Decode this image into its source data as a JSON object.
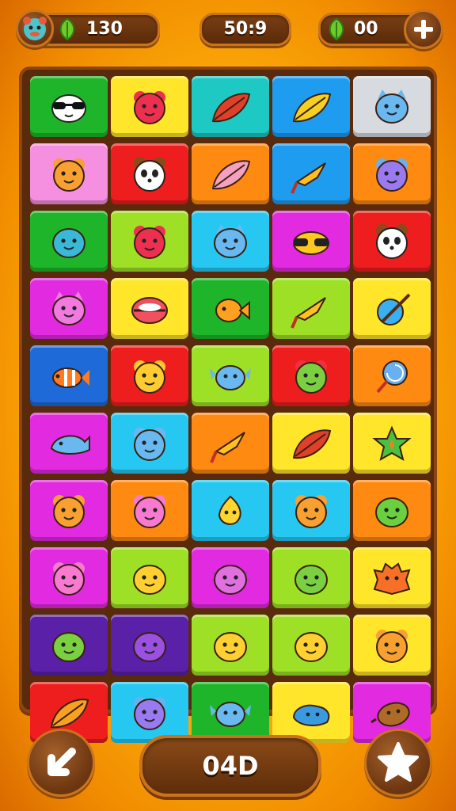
{
  "hud": {
    "lives_value": "130",
    "timer_value": "50:9",
    "coins_value": "00"
  },
  "bottom": {
    "center_value": "04D"
  },
  "colors": {
    "green": "#1fb52a",
    "yellow": "#ffe62a",
    "teal": "#1ec9c4",
    "blue": "#1e9cf0",
    "gray": "#d7dbe0",
    "pink": "#f58fe0",
    "red": "#ee1e1e",
    "orange": "#ff8a12",
    "lime": "#9de026",
    "cyan": "#26c8f2",
    "magenta": "#e22ae0",
    "purple": "#5a20a8",
    "royal": "#1e6ad8"
  },
  "tiles": [
    {
      "bg": "green",
      "icon": "panda-sunglasses"
    },
    {
      "bg": "yellow",
      "icon": "red-bear"
    },
    {
      "bg": "teal",
      "icon": "red-leaf"
    },
    {
      "bg": "blue",
      "icon": "yellow-leaf"
    },
    {
      "bg": "gray",
      "icon": "blue-cat"
    },
    {
      "bg": "pink",
      "icon": "orange-bear"
    },
    {
      "bg": "red",
      "icon": "panda-face"
    },
    {
      "bg": "orange",
      "icon": "pink-leaf"
    },
    {
      "bg": "blue",
      "icon": "kite"
    },
    {
      "bg": "orange",
      "icon": "purple-bear"
    },
    {
      "bg": "green",
      "icon": "teal-face"
    },
    {
      "bg": "lime",
      "icon": "red-bear"
    },
    {
      "bg": "cyan",
      "icon": "blue-cat"
    },
    {
      "bg": "magenta",
      "icon": "yellow-sunglasses"
    },
    {
      "bg": "red",
      "icon": "panda-face"
    },
    {
      "bg": "magenta",
      "icon": "pink-cat"
    },
    {
      "bg": "yellow",
      "icon": "red-clam"
    },
    {
      "bg": "green",
      "icon": "orange-fish"
    },
    {
      "bg": "lime",
      "icon": "kite"
    },
    {
      "bg": "yellow",
      "icon": "blue-ball"
    },
    {
      "bg": "royal",
      "icon": "clownfish"
    },
    {
      "bg": "red",
      "icon": "yellow-bear"
    },
    {
      "bg": "lime",
      "icon": "blue-fish"
    },
    {
      "bg": "red",
      "icon": "green-bear"
    },
    {
      "bg": "orange",
      "icon": "lollipop"
    },
    {
      "bg": "magenta",
      "icon": "blue-whale"
    },
    {
      "bg": "cyan",
      "icon": "blue-bear"
    },
    {
      "bg": "orange",
      "icon": "kite"
    },
    {
      "bg": "yellow",
      "icon": "red-leaf"
    },
    {
      "bg": "yellow",
      "icon": "green-star"
    },
    {
      "bg": "magenta",
      "icon": "orange-bear"
    },
    {
      "bg": "orange",
      "icon": "pink-bear"
    },
    {
      "bg": "cyan",
      "icon": "yellow-drop"
    },
    {
      "bg": "cyan",
      "icon": "orange-bear"
    },
    {
      "bg": "orange",
      "icon": "green-blob"
    },
    {
      "bg": "magenta",
      "icon": "pink-bear"
    },
    {
      "bg": "lime",
      "icon": "yellow-face"
    },
    {
      "bg": "magenta",
      "icon": "pink-axolotl"
    },
    {
      "bg": "lime",
      "icon": "green-face"
    },
    {
      "bg": "yellow",
      "icon": "orange-blob"
    },
    {
      "bg": "purple",
      "icon": "green-face"
    },
    {
      "bg": "purple",
      "icon": "purple-face"
    },
    {
      "bg": "lime",
      "icon": "yellow-face"
    },
    {
      "bg": "lime",
      "icon": "yellow-face"
    },
    {
      "bg": "yellow",
      "icon": "orange-bear"
    },
    {
      "bg": "red",
      "icon": "orange-leaf"
    },
    {
      "bg": "cyan",
      "icon": "purple-bear"
    },
    {
      "bg": "green",
      "icon": "blue-fish"
    },
    {
      "bg": "yellow",
      "icon": "blue-blob"
    },
    {
      "bg": "magenta",
      "icon": "brown-potato"
    }
  ]
}
